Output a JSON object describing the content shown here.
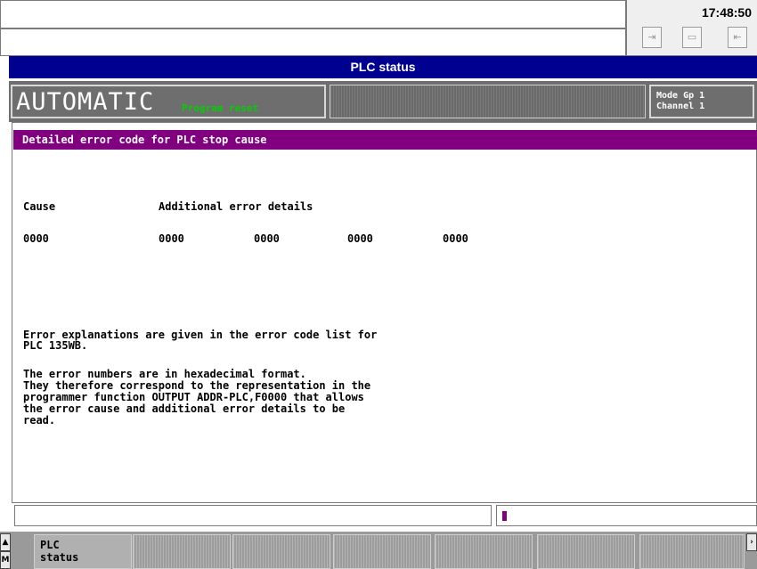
{
  "header": {
    "clock": "17:48:50",
    "icons": [
      "enter-icon",
      "display-icon",
      "exit-icon"
    ]
  },
  "title": "PLC status",
  "mode": {
    "label": "AUTOMATIC",
    "program_state": "Program reset",
    "mode_group": "Mode Gp 1",
    "channel": "Channel 1"
  },
  "panel": {
    "header": "Detailed error code for PLC stop cause",
    "cause_label": "Cause",
    "details_label": "Additional error details",
    "values": [
      "0000",
      "0000",
      "0000",
      "0000",
      "0000"
    ],
    "notes": [
      "Error explanations are given in the error code list for\nPLC 135WB.",
      "The error numbers are in hexadecimal format.\nThey therefore correspond to the representation in the\nprogrammer function OUTPUT ADDR-PLC,F0000 that allows\nthe error cause and additional error details to be\nread."
    ]
  },
  "colors": {
    "title_bar": "#000090",
    "panel_header": "#800080",
    "program_state": "#00d000"
  },
  "softkeys": {
    "first": "PLC\nstatus"
  }
}
